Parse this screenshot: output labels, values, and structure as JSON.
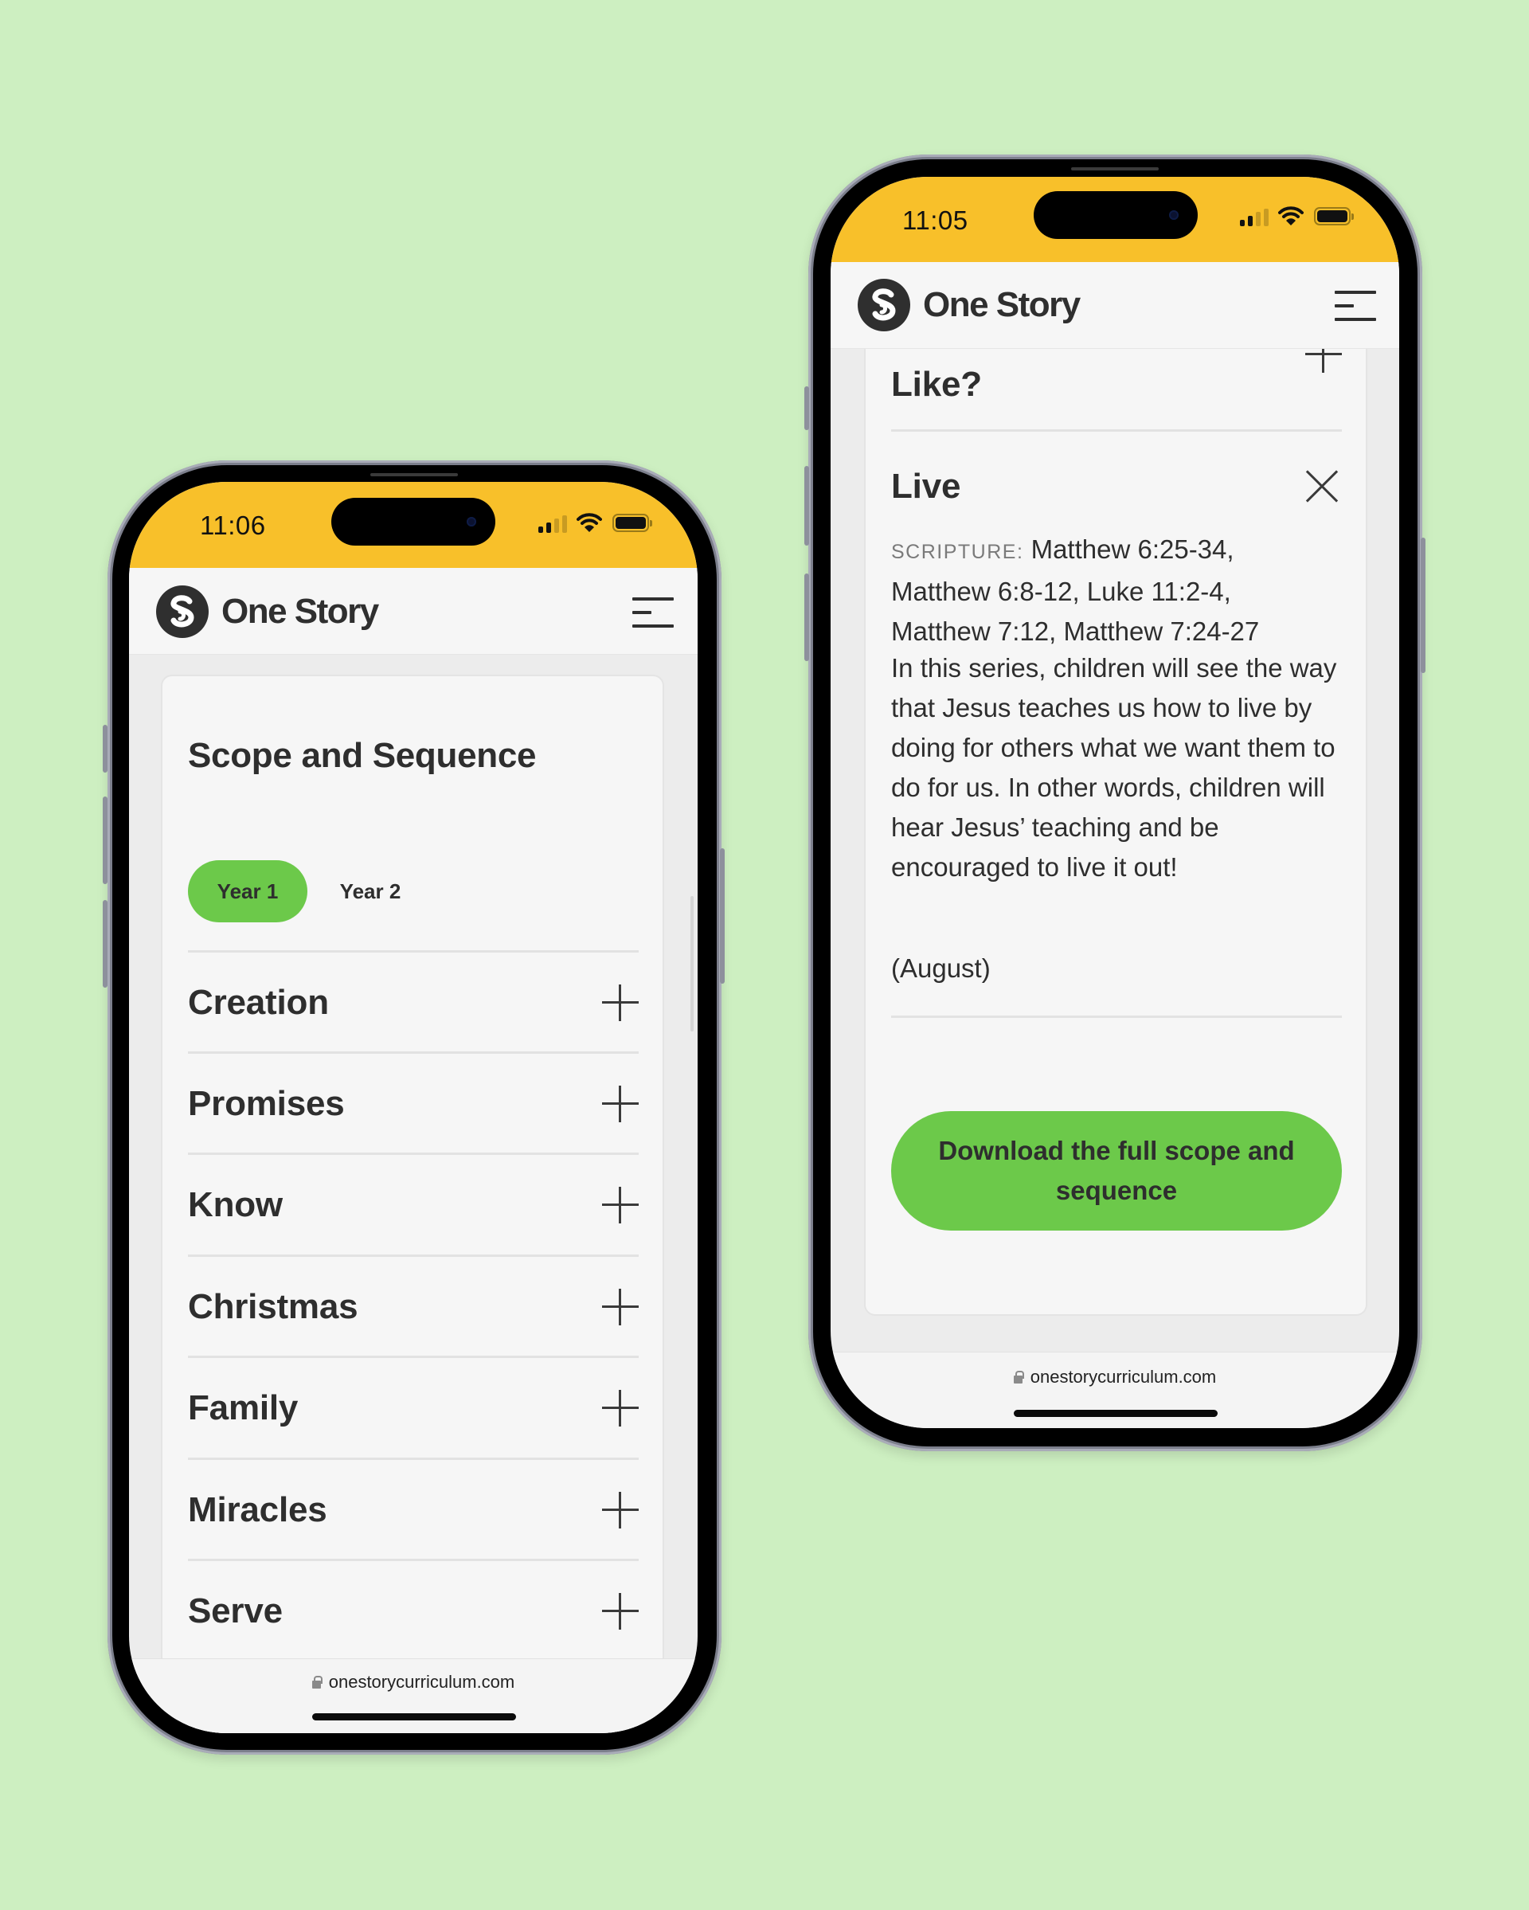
{
  "colors": {
    "background": "#cdefc1",
    "status_bar": "#f8c02a",
    "accent_green": "#6cc94a",
    "text_dark": "#2e2e2e"
  },
  "brand": {
    "name": "One Story",
    "logo_icon": "one-story-s-logo-icon"
  },
  "left_phone": {
    "status": {
      "time": "11:06",
      "icons": [
        "cellular-signal-icon",
        "wifi-icon",
        "battery-icon"
      ]
    },
    "header": {
      "brand": "One Story",
      "menu_icon": "hamburger-menu-icon"
    },
    "card": {
      "title": "Scope and Sequence",
      "tabs": [
        {
          "label": "Year 1",
          "active": true
        },
        {
          "label": "Year 2",
          "active": false
        }
      ],
      "accordion": [
        {
          "title": "Creation",
          "icon": "plus-icon"
        },
        {
          "title": "Promises",
          "icon": "plus-icon"
        },
        {
          "title": "Know",
          "icon": "plus-icon"
        },
        {
          "title": "Christmas",
          "icon": "plus-icon"
        },
        {
          "title": "Family",
          "icon": "plus-icon"
        },
        {
          "title": "Miracles",
          "icon": "plus-icon"
        },
        {
          "title": "Serve",
          "icon": "plus-icon"
        }
      ]
    },
    "browser": {
      "url": "onestorycurriculum.com",
      "lock_icon": "lock-icon"
    }
  },
  "right_phone": {
    "status": {
      "time": "11:05",
      "icons": [
        "cellular-signal-icon",
        "wifi-icon",
        "battery-icon"
      ]
    },
    "header": {
      "brand": "One Story",
      "menu_icon": "hamburger-menu-icon"
    },
    "card": {
      "collapsed_item": {
        "title": "Like?",
        "icon": "plus-icon"
      },
      "expanded_item": {
        "title": "Live",
        "icon": "close-icon",
        "scripture_label": "SCRIPTURE:",
        "scripture_lines": [
          "Matthew 6:25-34,",
          "Matthew 6:8-12, Luke 11:2-4,",
          "Matthew 7:12, Matthew 7:24-27"
        ],
        "description": "In this series, children will see the way that Jesus teaches us how to live by doing for others what we want them to do for us. In other words, children will hear Jesus’ teaching and be encouraged to live it out!",
        "month": "(August)"
      },
      "download_button": "Download the full scope and sequence"
    },
    "browser": {
      "url": "onestorycurriculum.com",
      "lock_icon": "lock-icon"
    }
  }
}
